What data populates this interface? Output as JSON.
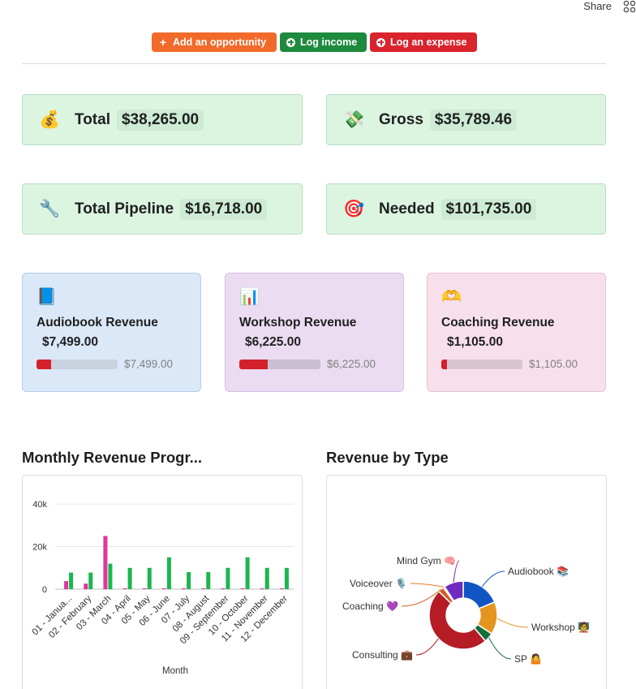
{
  "topbar": {
    "share_label": "Share"
  },
  "actions": {
    "add_opportunity": "Add an opportunity",
    "log_income": "Log income",
    "log_expense": "Log an expense"
  },
  "stats": {
    "total": {
      "emoji": "💰",
      "label": "Total",
      "value": "$38,265.00"
    },
    "gross": {
      "emoji": "💸",
      "label": "Gross",
      "value": "$35,789.46"
    },
    "pipeline": {
      "emoji": "🔧",
      "label": "Total Pipeline",
      "value": "$16,718.00"
    },
    "needed": {
      "emoji": "🎯",
      "label": "Needed",
      "value": "$101,735.00"
    }
  },
  "revenue_cards": [
    {
      "emoji": "📘",
      "title": "Audiobook Revenue",
      "amount": "$7,499.00",
      "progress": 0.18,
      "bar_label": "$7,499.00"
    },
    {
      "emoji": "📊",
      "title": "Workshop Revenue",
      "amount": "$6,225.00",
      "progress": 0.35,
      "bar_label": "$6,225.00"
    },
    {
      "emoji": "🫶",
      "title": "Coaching Revenue",
      "amount": "$1,105.00",
      "progress": 0.07,
      "bar_label": "$1,105.00"
    }
  ],
  "sections": {
    "monthly_title": "Monthly Revenue Progr...",
    "type_title": "Revenue by Type"
  },
  "colors": {
    "pink_series": "#e0359f",
    "green_series": "#1bb64e",
    "audiobook": "#1155c5",
    "workshop": "#e4951f",
    "sp": "#12703a",
    "consulting": "#b51c26",
    "coaching": "#d45a22",
    "voiceover": "#e07b2c",
    "mind_gym": "#6d2bc0"
  },
  "chart_data": [
    {
      "type": "bar",
      "title": "Monthly Revenue Progr...",
      "xlabel": "Month",
      "ylabel": "",
      "ylim": [
        0,
        45000
      ],
      "yticks": [
        "0",
        "20k",
        "40k"
      ],
      "categories": [
        "01 - Janua...",
        "02 - February",
        "03 - March",
        "04 - April",
        "05 - May",
        "06 - June",
        "07 - July",
        "08 - August",
        "09 - September",
        "10 - October",
        "11 - November",
        "12 - December"
      ],
      "series": [
        {
          "values": [
            3800,
            2600,
            25000,
            400,
            400,
            400,
            400,
            400,
            400,
            400,
            400,
            400
          ]
        },
        {
          "values": [
            7800,
            7800,
            12000,
            10000,
            10000,
            15000,
            8000,
            8000,
            10000,
            15000,
            10000,
            10000
          ]
        }
      ]
    },
    {
      "type": "pie",
      "title": "Revenue by Type",
      "labels": [
        "Audiobook 📚",
        "Workshop 🧑‍🏫",
        "SP 🤷",
        "Consulting 💼",
        "Coaching 💜",
        "Voiceover 🎙️",
        "Mind Gym 🧠"
      ],
      "values": [
        7499,
        6225,
        1800,
        19500,
        1105,
        300,
        3700
      ]
    }
  ]
}
